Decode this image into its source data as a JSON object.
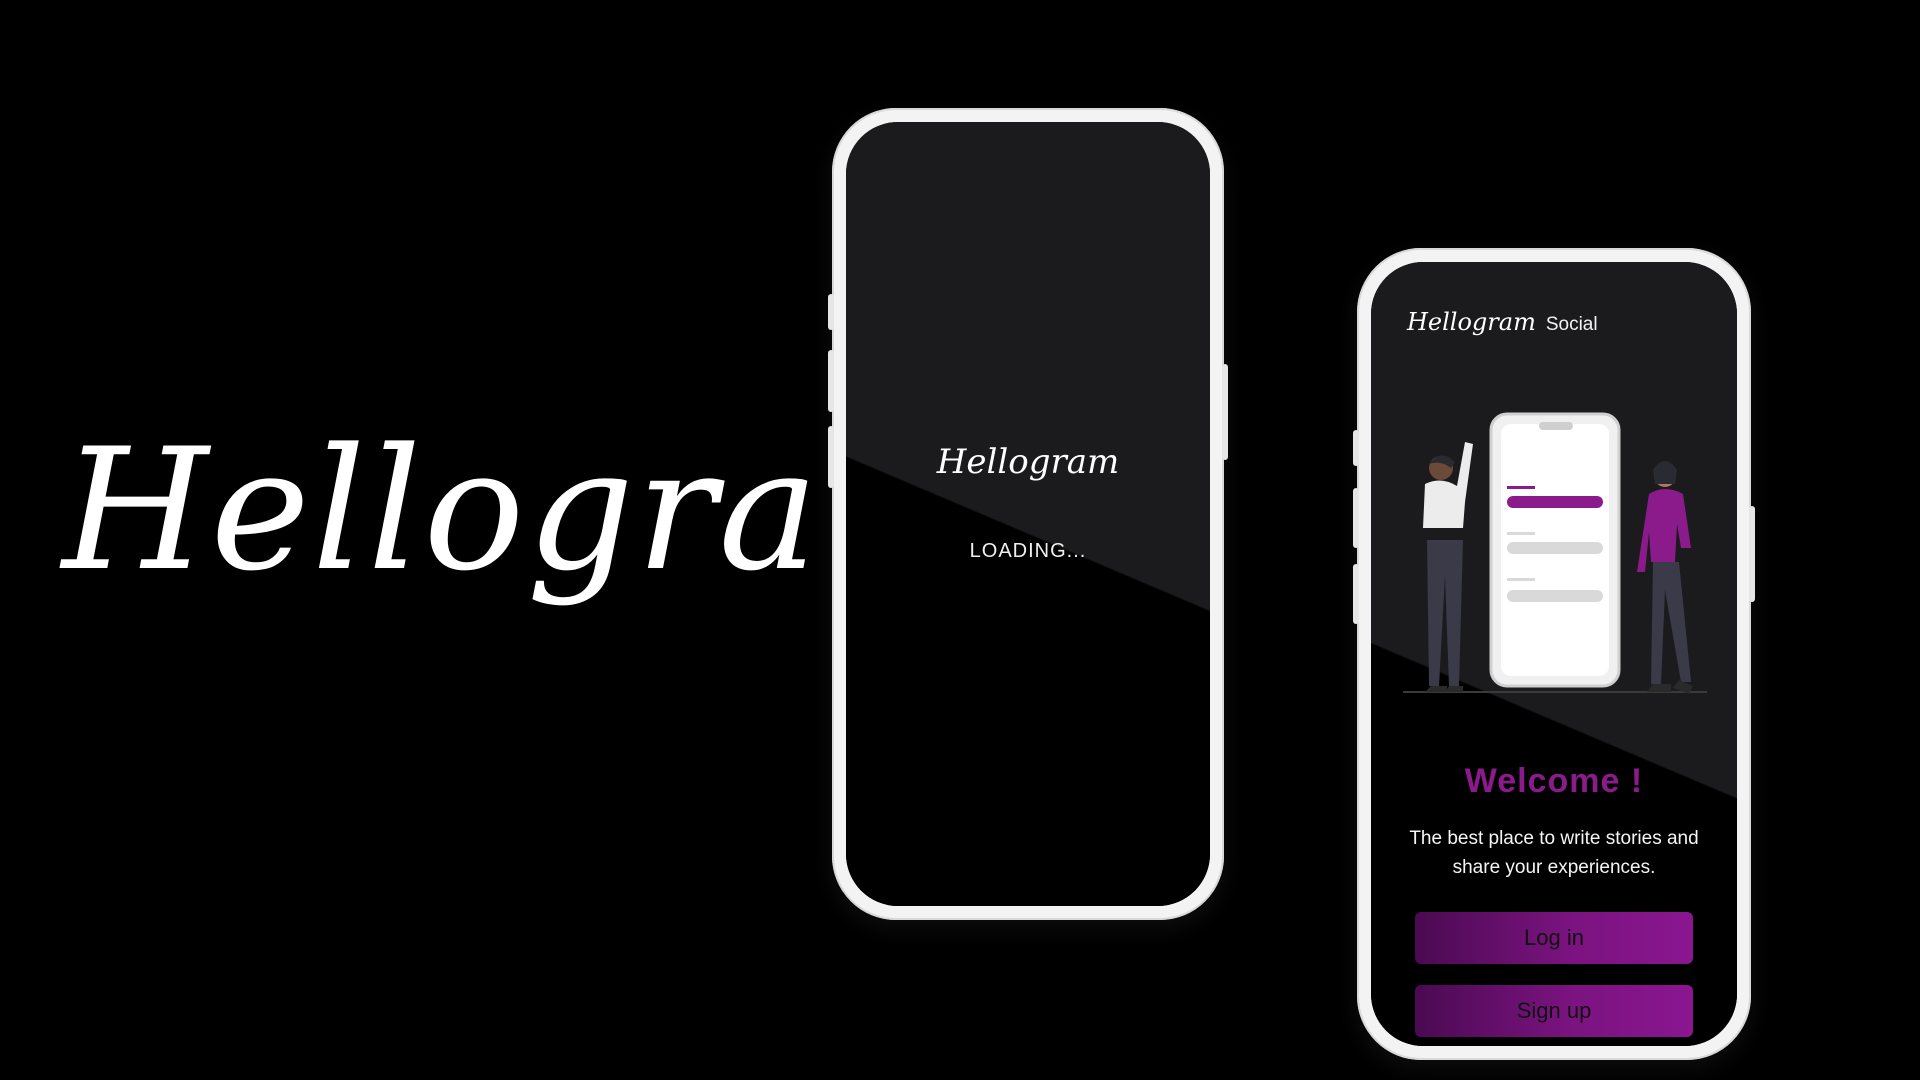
{
  "brand": {
    "logo_text": "Hellogram"
  },
  "splash": {
    "logo_text": "Hellogram",
    "status_text": "LOADING..."
  },
  "welcome_screen": {
    "header_logo": "Hellogram",
    "header_tag": "Social",
    "title": "Welcome !",
    "subtitle": "The best place to write stories and share your experiences.",
    "login_label": "Log in",
    "signup_label": "Sign up"
  },
  "colors": {
    "background": "#000000",
    "accent_purple": "#8b1a8b",
    "button_gradient_start": "#4a0a52",
    "button_gradient_end": "#8a1690",
    "phone_frame": "#f3f3f3"
  },
  "icons": [
    "illustration-people-with-phone"
  ]
}
